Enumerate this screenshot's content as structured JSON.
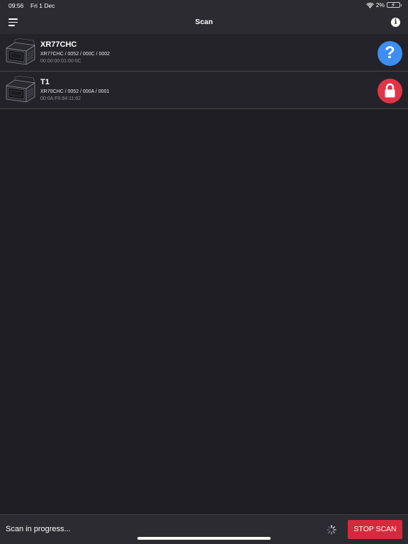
{
  "status_bar": {
    "time": "09:56",
    "date": "Fri 1 Dec",
    "battery": "2%",
    "wifi_icon": "wifi-icon",
    "battery_icon": "battery-charging-icon"
  },
  "nav": {
    "title": "Scan",
    "menu_icon": "hamburger-menu-icon",
    "info_icon": "info-icon"
  },
  "devices": [
    {
      "name": "XR77CHC",
      "model": "XR77CHC / 0052 / 000C / 0002",
      "mac": "00:00:00:01:00:0C",
      "status_icon": "question-icon",
      "status_color": "#3d8ef0"
    },
    {
      "name": "T1",
      "model": "XR70CHC / 0052 / 000A / 0001",
      "mac": "00:0A:F6:84:11:62",
      "status_icon": "lock-icon",
      "status_color": "#e03546"
    }
  ],
  "footer": {
    "status_text": "Scan in progress...",
    "stop_label": "STOP SCAN",
    "stop_color": "#d42a3b",
    "spinner_icon": "spinner-icon"
  }
}
